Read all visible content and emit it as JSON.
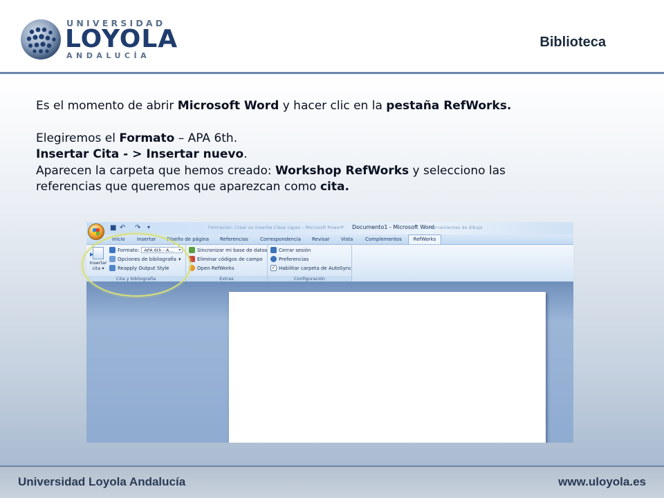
{
  "header": {
    "logo": {
      "top": "UNIVERSIDAD",
      "main": "LOYOLA",
      "bottom": "ANDALUCÍA"
    },
    "section_title": "Biblioteca"
  },
  "body": {
    "line1": {
      "a": "Es el momento de abrir  ",
      "b": "Microsoft Word",
      "c": " y hacer clic en la ",
      "d": "pestaña RefWorks."
    },
    "line2": {
      "a": "Elegiremos el ",
      "b": "Formato",
      "c": " – APA 6th."
    },
    "line3": {
      "a": "Insertar Cita - > Insertar nuevo",
      "b": "."
    },
    "line4": {
      "a": "Aparecen la carpeta que hemos creado: ",
      "b": "Workshop RefWorks",
      "c": " y selecciono las"
    },
    "line5": {
      "a": "referencias que queremos  que aparezcan como ",
      "b": "cita."
    }
  },
  "word": {
    "title_faded": "Formación: Crear ou Inserite Clase capas – Microsoft PowerP.",
    "title": "Documento1 - Microsoft Word",
    "title_faded_right": "Herramientas de dibujo",
    "tabs": [
      "Inicio",
      "Insertar",
      "Diseño de página",
      "Referencias",
      "Correspondencia",
      "Revisar",
      "Vista",
      "Complementos"
    ],
    "active_tab": "RefWorks",
    "groups": {
      "cita": {
        "insert_label": "Insertar cita",
        "format_label": "Formato:",
        "format_value": "APA 6th - A...",
        "bib_options": "Opciones de bibliografía",
        "reapply": "Reapply Output Style",
        "label": "Cita y bibliografía"
      },
      "extras": {
        "sync": "Sincronizar mi base de datos",
        "remove": "Eliminar códigos de campo",
        "open": "Open RefWorks",
        "label": "Extras"
      },
      "config": {
        "logout": "Cerrar sesión",
        "prefs": "Preferencias",
        "autosync": "Habilitar carpeta de AutoSync",
        "label": "Configuración"
      }
    }
  },
  "footer": {
    "left": "Universidad Loyola Andalucía",
    "right": "www.uloyola.es"
  },
  "colors": {
    "brand_navy": "#1f3c6e",
    "rule_blue": "#6a86a8",
    "highlight": "#d8e07a"
  }
}
